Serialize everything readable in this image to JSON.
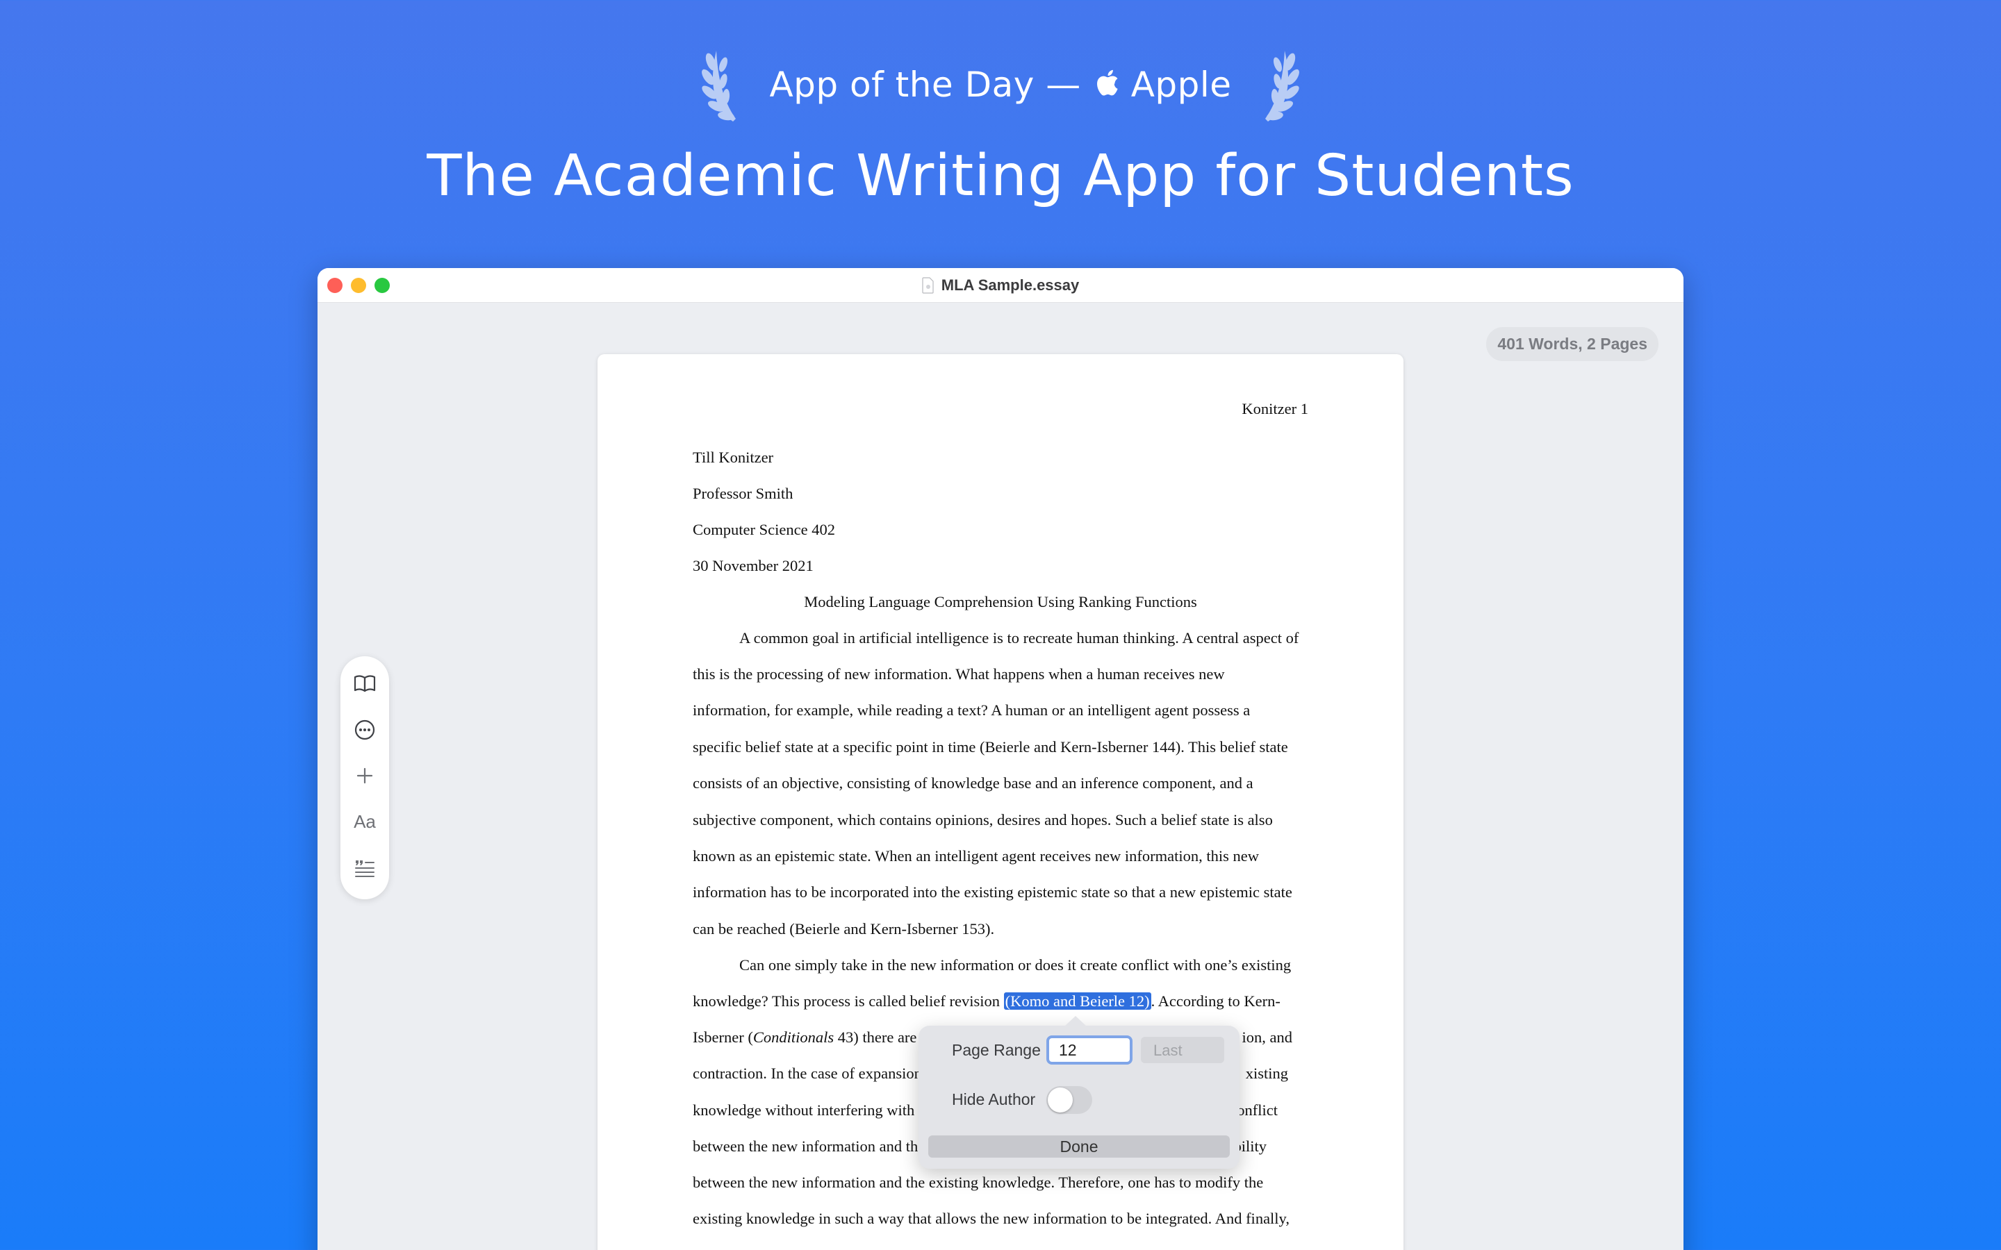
{
  "hero": {
    "award_prefix": "App of the Day —",
    "award_brand": "Apple",
    "title": "The Academic Writing App for Students"
  },
  "window": {
    "title": "MLA Sample.essay",
    "word_count": "401 Words, 2 Pages"
  },
  "toolbar": {
    "items": [
      "book-icon",
      "ellipsis-circle-icon",
      "plus-icon",
      "font-icon",
      "quote-list-icon"
    ],
    "font_label": "Aa"
  },
  "document": {
    "page_header": "Konitzer 1",
    "author": "Till Konitzer",
    "professor": "Professor Smith",
    "course": "Computer Science 402",
    "date": "30 November 2021",
    "title": "Modeling Language Comprehension Using Ranking Functions",
    "lines": [
      "A common goal in artificial intelligence is to recreate human thinking. A central aspect of",
      "this is the processing of new information. What happens when a human receives new",
      "information, for example, while reading a text? A human or an intelligent agent possess a",
      "specific belief state at a specific point in time (Beierle and Kern-Isberner 144). This belief state",
      "consists of an objective, consisting of knowledge base and an inference component, and a",
      "subjective component, which contains opinions, desires and hopes. Such a belief state is also",
      "known as an epistemic state. When an intelligent agent receives new information, this new",
      "information has to be incorporated into the existing epistemic state so that a new epistemic state",
      "can be reached (Beierle and Kern-Isberner 153).",
      "Can one simply take in the new information or does it create conflict with one’s existing"
    ],
    "line_revision_before": "knowledge? This process is called belief revision ",
    "line_revision_citation": "(Komo and Beierle 12)",
    "line_revision_after": ". According to Kern-",
    "line_12_start": "Isberner (",
    "line_12_italic": "Conditionals",
    "line_12_mid": " 43) there are",
    "line_12_end": "ion, and",
    "line_13_start": "contraction. In the case of expansion",
    "line_13_end": "xisting",
    "line_14_start": "knowledge without interfering with",
    "line_14_end": "onflict",
    "line_15_start": "between the new information and th",
    "line_15_end": "bility",
    "line_16": "between the new information and the existing knowledge. Therefore, one has to modify the",
    "line_17": "existing knowledge in such a way that allows the new information to be integrated. And finally,"
  },
  "popover": {
    "page_range_label": "Page Range",
    "page_range_value": "12",
    "last_placeholder": "Last",
    "hide_author_label": "Hide Author",
    "hide_author_on": false,
    "done_label": "Done"
  }
}
